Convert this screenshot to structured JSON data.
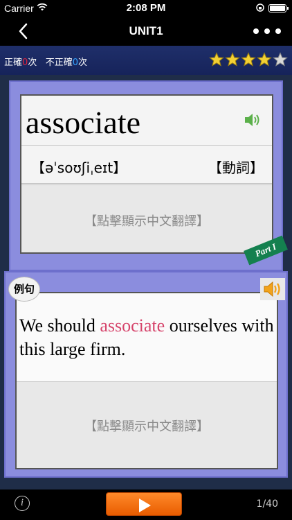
{
  "status": {
    "carrier": "Carrier",
    "time": "2:08 PM"
  },
  "nav": {
    "title": "UNIT1"
  },
  "score": {
    "correct_label": "正確",
    "correct_count": "0",
    "times1": "次",
    "incorrect_label": "不正確",
    "incorrect_count": "0",
    "times2": "次",
    "stars_filled": 4,
    "stars_total": 5
  },
  "word_card": {
    "word": "associate",
    "phonetic": "【əˈsoʊʃiˌeɪt】",
    "part_of_speech": "【動詞】",
    "translation_hint": "【點擊顯示中文翻譯】",
    "part_tag": "Part I"
  },
  "sentence_card": {
    "badge": "例句",
    "sentence_before": "We should ",
    "sentence_highlight": "associate",
    "sentence_after": " ourselves with this large firm.",
    "translation_hint": "【點擊顯示中文翻譯】",
    "highlight_color": "#d6456c"
  },
  "toolbar": {
    "info_glyph": "i",
    "page_indicator": "1/40"
  },
  "colors": {
    "card_bg": "#8b8dde",
    "main_bg": "#1f2d48",
    "play_button": "#ff7a1a",
    "star": "#f3d034"
  }
}
